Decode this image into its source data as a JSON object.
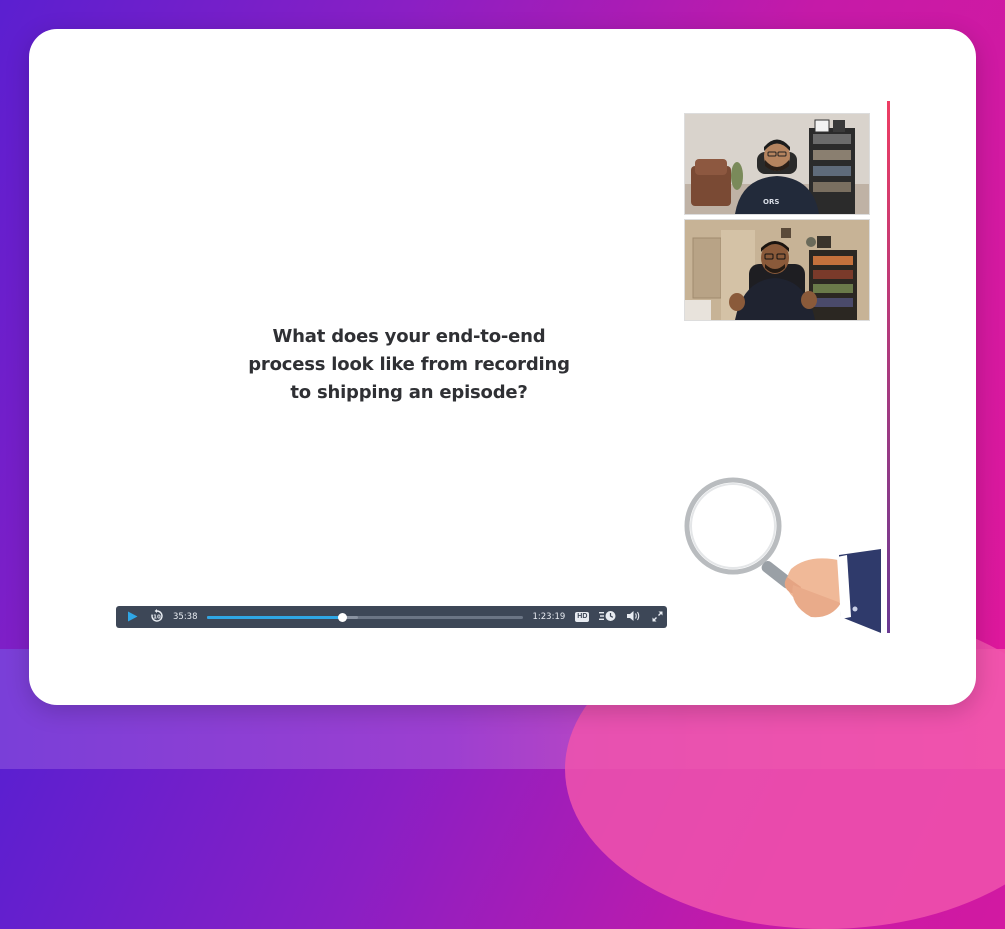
{
  "slide": {
    "question_lines": [
      "What does your end-to-end",
      "process look like from recording",
      "to shipping an episode?"
    ]
  },
  "player": {
    "current_time": "35:38",
    "duration": "1:23:19",
    "progress": 0.43,
    "buffered": 0.48,
    "quality_badge": "HD",
    "accent_color": "#2fa7e6",
    "bar_color": "#3d4757",
    "icons": [
      "play-icon",
      "replay-10-icon",
      "hd-icon",
      "speed-icon",
      "volume-icon",
      "fullscreen-icon"
    ]
  },
  "videos": [
    {
      "name": "participant-1"
    },
    {
      "name": "participant-2"
    }
  ],
  "colors": {
    "divider_top": "#ee3d63",
    "divider_bottom": "#6a3a93",
    "text": "#2f3034"
  }
}
